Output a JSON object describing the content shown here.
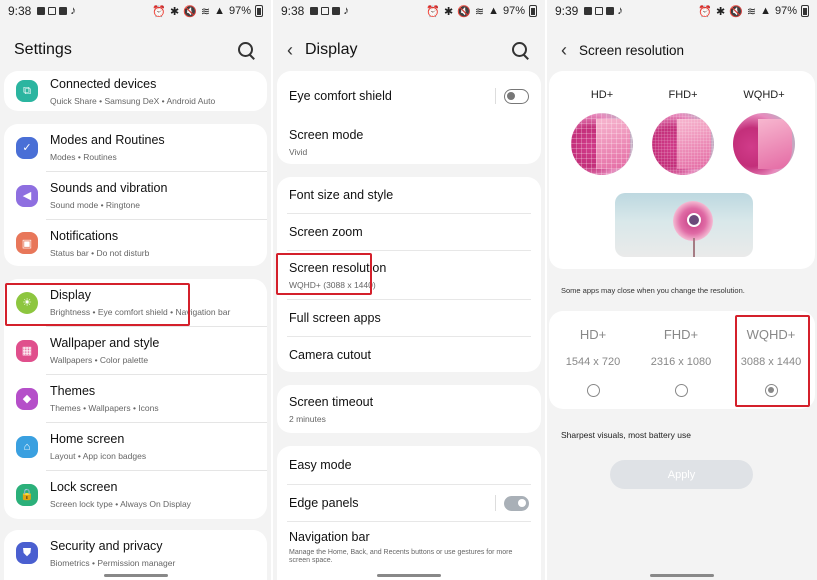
{
  "panel1": {
    "status": {
      "time": "9:38",
      "battery": "97%"
    },
    "title": "Settings",
    "items": [
      {
        "label": "Connected devices",
        "sub": "Quick Share  •  Samsung DeX  •  Android Auto",
        "icon": "connected-devices-icon",
        "color": "#2bb5a0"
      },
      {
        "label": "Modes and Routines",
        "sub": "Modes  •  Routines",
        "icon": "modes-routines-icon",
        "color": "#4a6fd6"
      },
      {
        "label": "Sounds and vibration",
        "sub": "Sound mode  •  Ringtone",
        "icon": "sound-icon",
        "color": "#8e6fe0"
      },
      {
        "label": "Notifications",
        "sub": "Status bar  •  Do not disturb",
        "icon": "notifications-icon",
        "color": "#e8775a"
      },
      {
        "label": "Display",
        "sub": "Brightness  •  Eye comfort shield  •  Navigation bar",
        "icon": "display-icon",
        "color": "#8dc63f"
      },
      {
        "label": "Wallpaper and style",
        "sub": "Wallpapers  •  Color palette",
        "icon": "wallpaper-icon",
        "color": "#e04f8c"
      },
      {
        "label": "Themes",
        "sub": "Themes  •  Wallpapers  •  Icons",
        "icon": "themes-icon",
        "color": "#b54fc9"
      },
      {
        "label": "Home screen",
        "sub": "Layout  •  App icon badges",
        "icon": "home-screen-icon",
        "color": "#3aa0e0"
      },
      {
        "label": "Lock screen",
        "sub": "Screen lock type  •  Always On Display",
        "icon": "lock-screen-icon",
        "color": "#2bb07a"
      },
      {
        "label": "Security and privacy",
        "sub": "Biometrics  •  Permission manager",
        "icon": "security-icon",
        "color": "#4a5fd0"
      }
    ]
  },
  "panel2": {
    "status": {
      "time": "9:38",
      "battery": "97%"
    },
    "title": "Display",
    "items": [
      {
        "label": "Eye comfort shield",
        "sub": ""
      },
      {
        "label": "Screen mode",
        "sub": "Vivid"
      },
      {
        "label": "Font size and style",
        "sub": ""
      },
      {
        "label": "Screen zoom",
        "sub": ""
      },
      {
        "label": "Screen resolution",
        "sub": "WQHD+ (3088 x 1440)"
      },
      {
        "label": "Full screen apps",
        "sub": ""
      },
      {
        "label": "Camera cutout",
        "sub": ""
      },
      {
        "label": "Screen timeout",
        "sub": "2 minutes"
      },
      {
        "label": "Easy mode",
        "sub": ""
      },
      {
        "label": "Edge panels",
        "sub": ""
      },
      {
        "label": "Navigation bar",
        "sub": "Manage the Home, Back, and Recents buttons or use gestures for more screen space."
      }
    ]
  },
  "panel3": {
    "status": {
      "time": "9:39",
      "battery": "97%"
    },
    "title": "Screen resolution",
    "preview_labels": [
      "HD+",
      "FHD+",
      "WQHD+"
    ],
    "note": "Some apps may close when you change the resolution.",
    "options": [
      {
        "name": "HD+",
        "res": "1544 x 720",
        "selected": false
      },
      {
        "name": "FHD+",
        "res": "2316 x 1080",
        "selected": false
      },
      {
        "name": "WQHD+",
        "res": "3088 x 1440",
        "selected": true
      }
    ],
    "description": "Sharpest visuals, most battery use",
    "apply_label": "Apply"
  },
  "colors": {
    "highlight": "#d4202b",
    "panel_bg": "#f3f3f3"
  }
}
